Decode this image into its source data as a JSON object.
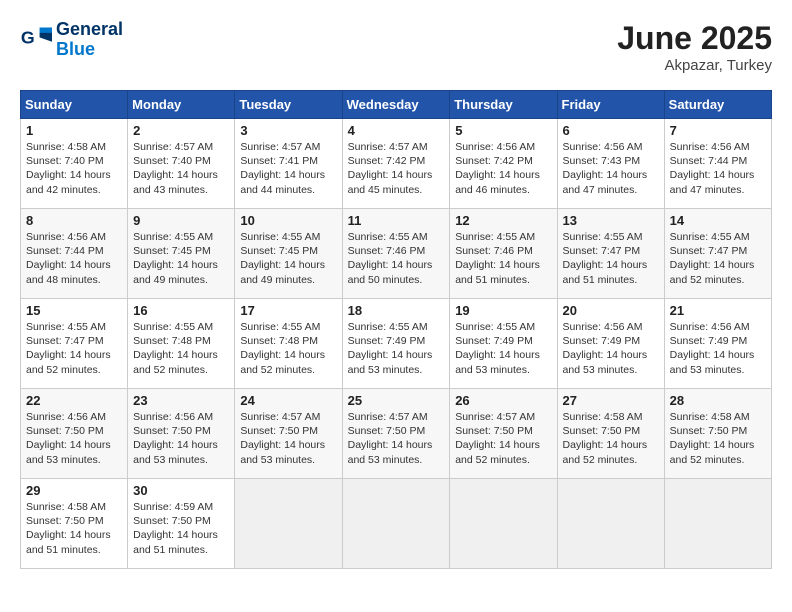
{
  "logo": {
    "line1": "General",
    "line2": "Blue"
  },
  "title": "June 2025",
  "subtitle": "Akpazar, Turkey",
  "weekdays": [
    "Sunday",
    "Monday",
    "Tuesday",
    "Wednesday",
    "Thursday",
    "Friday",
    "Saturday"
  ],
  "weeks": [
    [
      {
        "day": "1",
        "sunrise": "4:58 AM",
        "sunset": "7:40 PM",
        "daylight": "14 hours and 42 minutes."
      },
      {
        "day": "2",
        "sunrise": "4:57 AM",
        "sunset": "7:40 PM",
        "daylight": "14 hours and 43 minutes."
      },
      {
        "day": "3",
        "sunrise": "4:57 AM",
        "sunset": "7:41 PM",
        "daylight": "14 hours and 44 minutes."
      },
      {
        "day": "4",
        "sunrise": "4:57 AM",
        "sunset": "7:42 PM",
        "daylight": "14 hours and 45 minutes."
      },
      {
        "day": "5",
        "sunrise": "4:56 AM",
        "sunset": "7:42 PM",
        "daylight": "14 hours and 46 minutes."
      },
      {
        "day": "6",
        "sunrise": "4:56 AM",
        "sunset": "7:43 PM",
        "daylight": "14 hours and 47 minutes."
      },
      {
        "day": "7",
        "sunrise": "4:56 AM",
        "sunset": "7:44 PM",
        "daylight": "14 hours and 47 minutes."
      }
    ],
    [
      {
        "day": "8",
        "sunrise": "4:56 AM",
        "sunset": "7:44 PM",
        "daylight": "14 hours and 48 minutes."
      },
      {
        "day": "9",
        "sunrise": "4:55 AM",
        "sunset": "7:45 PM",
        "daylight": "14 hours and 49 minutes."
      },
      {
        "day": "10",
        "sunrise": "4:55 AM",
        "sunset": "7:45 PM",
        "daylight": "14 hours and 49 minutes."
      },
      {
        "day": "11",
        "sunrise": "4:55 AM",
        "sunset": "7:46 PM",
        "daylight": "14 hours and 50 minutes."
      },
      {
        "day": "12",
        "sunrise": "4:55 AM",
        "sunset": "7:46 PM",
        "daylight": "14 hours and 51 minutes."
      },
      {
        "day": "13",
        "sunrise": "4:55 AM",
        "sunset": "7:47 PM",
        "daylight": "14 hours and 51 minutes."
      },
      {
        "day": "14",
        "sunrise": "4:55 AM",
        "sunset": "7:47 PM",
        "daylight": "14 hours and 52 minutes."
      }
    ],
    [
      {
        "day": "15",
        "sunrise": "4:55 AM",
        "sunset": "7:47 PM",
        "daylight": "14 hours and 52 minutes."
      },
      {
        "day": "16",
        "sunrise": "4:55 AM",
        "sunset": "7:48 PM",
        "daylight": "14 hours and 52 minutes."
      },
      {
        "day": "17",
        "sunrise": "4:55 AM",
        "sunset": "7:48 PM",
        "daylight": "14 hours and 52 minutes."
      },
      {
        "day": "18",
        "sunrise": "4:55 AM",
        "sunset": "7:49 PM",
        "daylight": "14 hours and 53 minutes."
      },
      {
        "day": "19",
        "sunrise": "4:55 AM",
        "sunset": "7:49 PM",
        "daylight": "14 hours and 53 minutes."
      },
      {
        "day": "20",
        "sunrise": "4:56 AM",
        "sunset": "7:49 PM",
        "daylight": "14 hours and 53 minutes."
      },
      {
        "day": "21",
        "sunrise": "4:56 AM",
        "sunset": "7:49 PM",
        "daylight": "14 hours and 53 minutes."
      }
    ],
    [
      {
        "day": "22",
        "sunrise": "4:56 AM",
        "sunset": "7:50 PM",
        "daylight": "14 hours and 53 minutes."
      },
      {
        "day": "23",
        "sunrise": "4:56 AM",
        "sunset": "7:50 PM",
        "daylight": "14 hours and 53 minutes."
      },
      {
        "day": "24",
        "sunrise": "4:57 AM",
        "sunset": "7:50 PM",
        "daylight": "14 hours and 53 minutes."
      },
      {
        "day": "25",
        "sunrise": "4:57 AM",
        "sunset": "7:50 PM",
        "daylight": "14 hours and 53 minutes."
      },
      {
        "day": "26",
        "sunrise": "4:57 AM",
        "sunset": "7:50 PM",
        "daylight": "14 hours and 52 minutes."
      },
      {
        "day": "27",
        "sunrise": "4:58 AM",
        "sunset": "7:50 PM",
        "daylight": "14 hours and 52 minutes."
      },
      {
        "day": "28",
        "sunrise": "4:58 AM",
        "sunset": "7:50 PM",
        "daylight": "14 hours and 52 minutes."
      }
    ],
    [
      {
        "day": "29",
        "sunrise": "4:58 AM",
        "sunset": "7:50 PM",
        "daylight": "14 hours and 51 minutes."
      },
      {
        "day": "30",
        "sunrise": "4:59 AM",
        "sunset": "7:50 PM",
        "daylight": "14 hours and 51 minutes."
      },
      null,
      null,
      null,
      null,
      null
    ]
  ],
  "labels": {
    "sunrise": "Sunrise:",
    "sunset": "Sunset:",
    "daylight": "Daylight:"
  }
}
